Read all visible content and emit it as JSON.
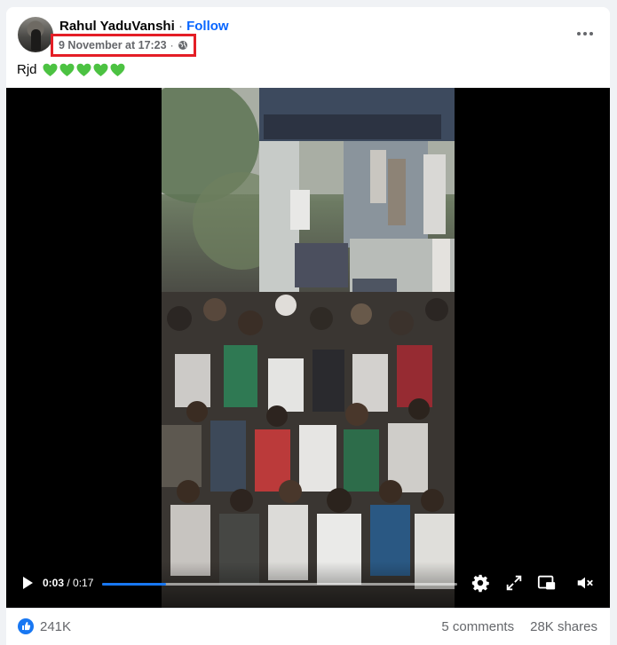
{
  "post": {
    "author": "Rahul YaduVanshi",
    "separator": "·",
    "follow_label": "Follow",
    "timestamp": "9 November at 17:23",
    "audience_icon": "globe-icon",
    "more_icon": "more-options-icon",
    "text": "Rjd",
    "emoji": [
      "💚",
      "💚",
      "💚",
      "💚",
      "💚"
    ]
  },
  "video": {
    "current_time": "0:03",
    "separator": " / ",
    "duration": "0:17",
    "progress": 0.18,
    "controls": [
      "play-icon",
      "settings-icon",
      "fullscreen-icon",
      "picture-in-picture-icon",
      "mute-icon"
    ]
  },
  "footer": {
    "likes": "241K",
    "comments": "5 comments",
    "shares": "28K shares"
  },
  "colors": {
    "accent": "#0866ff",
    "highlight_box": "#e41e26",
    "heart": "#4cc242",
    "progress": "#1877f2"
  }
}
